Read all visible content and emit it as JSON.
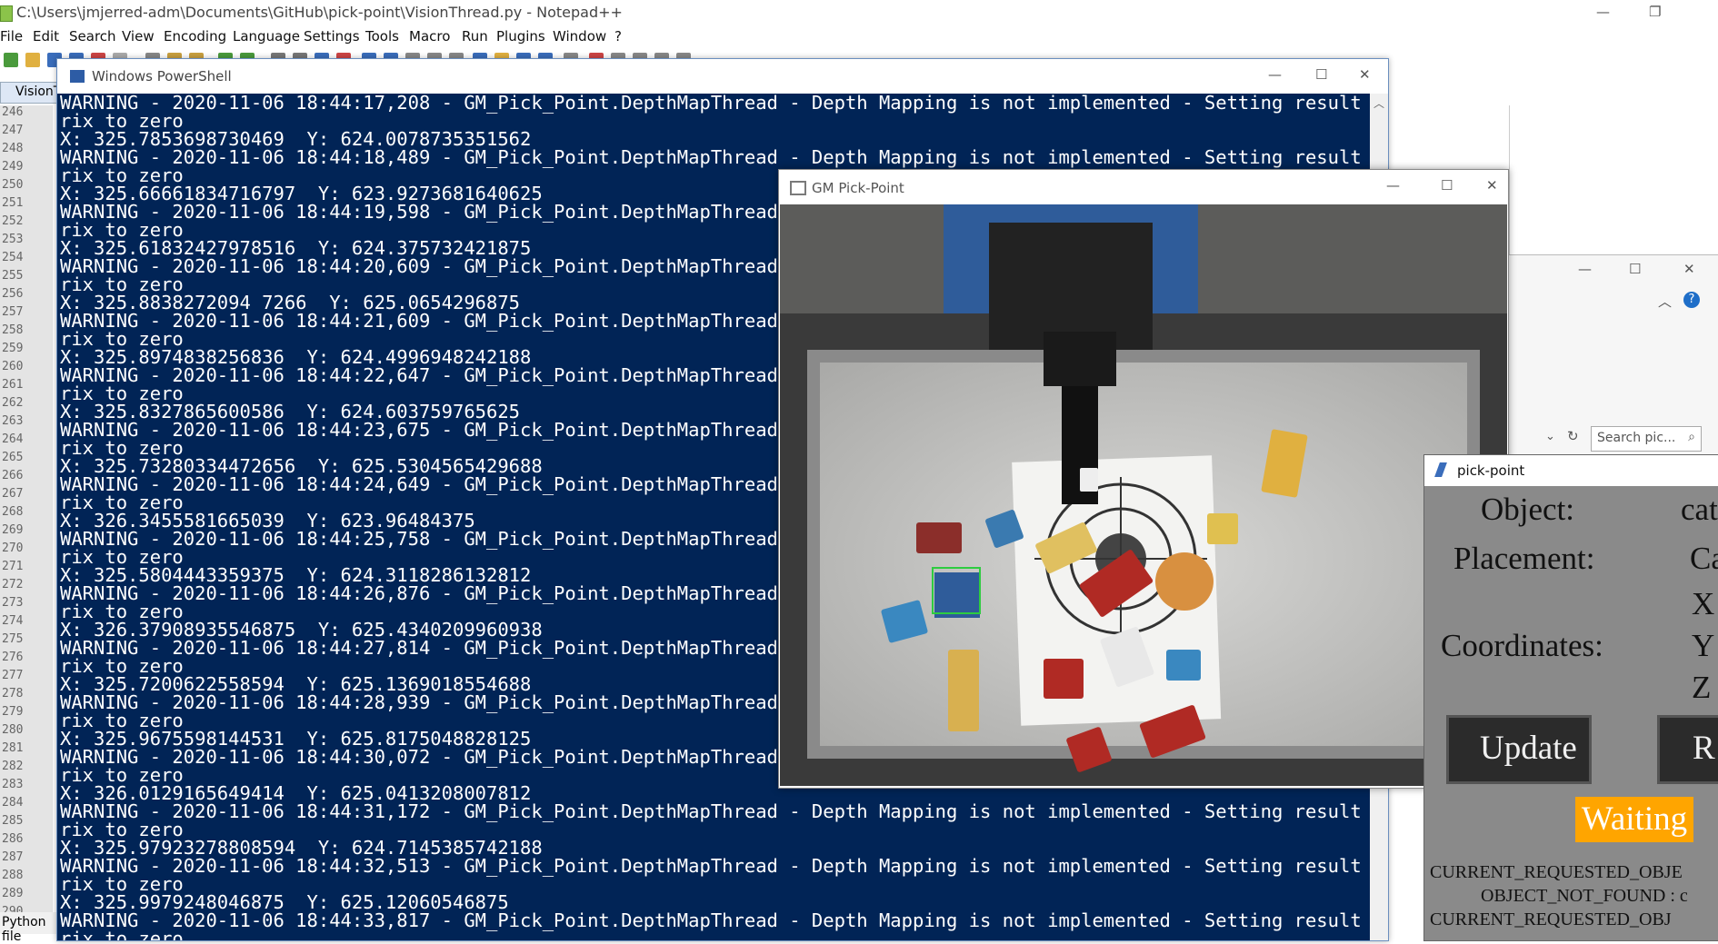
{
  "notepad": {
    "title": "C:\\Users\\jmjerred-adm\\Documents\\GitHub\\pick-point\\VisionThread.py - Notepad++",
    "menu": [
      "File",
      "Edit",
      "Search",
      "View",
      "Encoding",
      "Language",
      "Settings",
      "Tools",
      "Macro",
      "Run",
      "Plugins",
      "Window",
      "?"
    ],
    "tab": "VisionT",
    "status": "Python file",
    "line_numbers": [
      "246",
      "247",
      "248",
      "249",
      "250",
      "251",
      "252",
      "253",
      "254",
      "255",
      "256",
      "257",
      "258",
      "259",
      "260",
      "261",
      "262",
      "263",
      "264",
      "265",
      "266",
      "267",
      "268",
      "269",
      "270",
      "271",
      "272",
      "273",
      "274",
      "275",
      "276",
      "277",
      "278",
      "279",
      "280",
      "281",
      "282",
      "283",
      "284",
      "285",
      "286",
      "287",
      "288",
      "289",
      "290"
    ]
  },
  "powershell": {
    "title": "Windows PowerShell",
    "lines": [
      "WARNING - 2020-11-06 18:44:17,208 - GM_Pick_Point.DepthMapThread - Depth Mapping is not implemented - Setting result mat",
      "rix to zero",
      "X: 325.7853698730469  Y: 624.0078735351562",
      "WARNING - 2020-11-06 18:44:18,489 - GM_Pick_Point.DepthMapThread - Depth Mapping is not implemented - Setting result mat",
      "rix to zero",
      "X: 325.66661834716797  Y: 623.9273681640625",
      "WARNING - 2020-11-06 18:44:19,598 - GM_Pick_Point.DepthMapThread -",
      "rix to zero",
      "X: 325.61832427978516  Y: 624.375732421875",
      "WARNING - 2020-11-06 18:44:20,609 - GM_Pick_Point.DepthMapThread -",
      "rix to zero",
      "X: 325.8838272094 7266  Y: 625.0654296875",
      "WARNING - 2020-11-06 18:44:21,609 - GM_Pick_Point.DepthMapThread -",
      "rix to zero",
      "X: 325.8974838256836  Y: 624.4996948242188",
      "WARNING - 2020-11-06 18:44:22,647 - GM_Pick_Point.DepthMapThread -",
      "rix to zero",
      "X: 325.8327865600586  Y: 624.603759765625",
      "WARNING - 2020-11-06 18:44:23,675 - GM_Pick_Point.DepthMapThread -",
      "rix to zero",
      "X: 325.73280334472656  Y: 625.5304565429688",
      "WARNING - 2020-11-06 18:44:24,649 - GM_Pick_Point.DepthMapThread -",
      "rix to zero",
      "X: 326.3455581665039  Y: 623.96484375",
      "WARNING - 2020-11-06 18:44:25,758 - GM_Pick_Point.DepthMapThread -",
      "rix to zero",
      "X: 325.5804443359375  Y: 624.3118286132812",
      "WARNING - 2020-11-06 18:44:26,876 - GM_Pick_Point.DepthMapThread -",
      "rix to zero",
      "X: 326.37908935546875  Y: 625.4340209960938",
      "WARNING - 2020-11-06 18:44:27,814 - GM_Pick_Point.DepthMapThread -",
      "rix to zero",
      "X: 325.7200622558594  Y: 625.1369018554688",
      "WARNING - 2020-11-06 18:44:28,939 - GM_Pick_Point.DepthMapThread -",
      "rix to zero",
      "X: 325.9675598144531  Y: 625.8175048828125",
      "WARNING - 2020-11-06 18:44:30,072 - GM_Pick_Point.DepthMapThread -",
      "rix to zero",
      "X: 326.0129165649414  Y: 625.0413208007812",
      "WARNING - 2020-11-06 18:44:31,172 - GM_Pick_Point.DepthMapThread - Depth Mapping is not implemented - Setting result mat",
      "rix to zero",
      "X: 325.97923278808594  Y: 624.7145385742188",
      "WARNING - 2020-11-06 18:44:32,513 - GM_Pick_Point.DepthMapThread - Depth Mapping is not implemented - Setting result mat",
      "rix to zero",
      "X: 325.9979248046875  Y: 625.12060546875",
      "WARNING - 2020-11-06 18:44:33,817 - GM_Pick_Point.DepthMapThread - Depth Mapping is not implemented - Setting result mat",
      "rix to zero"
    ]
  },
  "gm_window": {
    "title": "GM Pick-Point"
  },
  "explorer": {
    "search_placeholder": "Search pic..."
  },
  "pick_point": {
    "title": "pick-point",
    "object_label": "Object:",
    "object_value": "cat",
    "placement_label": "Placement:",
    "placement_value": "Ca",
    "coordinates_label": "Coordinates:",
    "coord_x": "X",
    "coord_y": "Y",
    "coord_z": "Z",
    "update_button": "Update",
    "second_button": "R",
    "status": "Waiting",
    "log": [
      "CURRENT_REQUESTED_OBJE",
      "OBJECT_NOT_FOUND : c",
      "CURRENT_REQUESTED_OBJ"
    ]
  }
}
